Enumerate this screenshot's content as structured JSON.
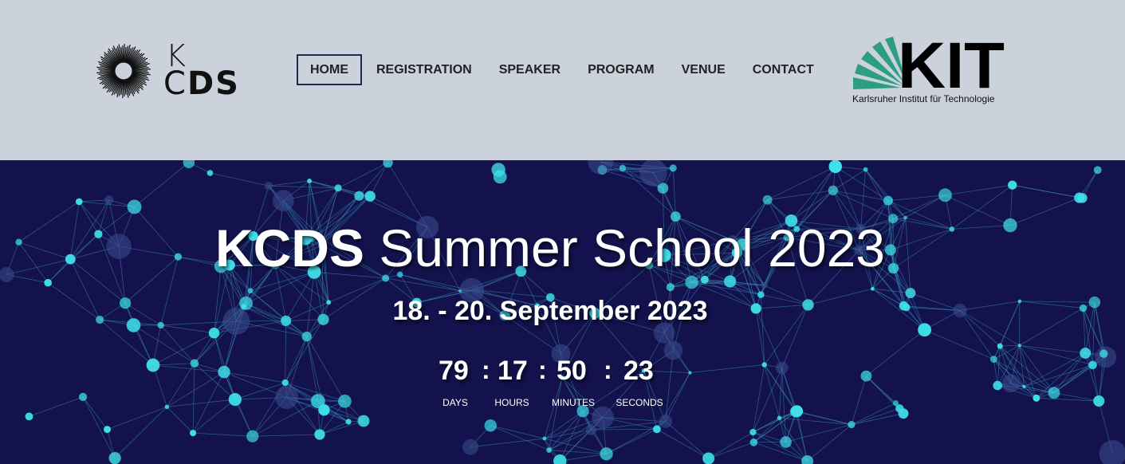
{
  "header": {
    "logo_k": "K",
    "logo_c": "C",
    "logo_ds": "DS",
    "nav": [
      {
        "label": "HOME",
        "active": true
      },
      {
        "label": "REGISTRATION",
        "active": false
      },
      {
        "label": "SPEAKER",
        "active": false
      },
      {
        "label": "PROGRAM",
        "active": false
      },
      {
        "label": "VENUE",
        "active": false
      },
      {
        "label": "CONTACT",
        "active": false
      }
    ],
    "kit_wordmark": "KIT",
    "kit_subtitle": "Karlsruher Institut für Technologie"
  },
  "hero": {
    "title_bold": "KCDS",
    "title_rest": " Summer School 2023",
    "dates": "18. - 20. September 2023",
    "countdown": {
      "days": "79",
      "hours": "17",
      "minutes": "50",
      "seconds": "23",
      "separator": ":",
      "days_label": "DAYS",
      "hours_label": "HOURS",
      "minutes_label": "MINUTES",
      "seconds_label": "SECONDS"
    }
  },
  "colors": {
    "header_bg": "#cbd2dc",
    "hero_bg": "#13124d",
    "node": "#3fe0e8",
    "kit_green": "#2e9e82"
  }
}
